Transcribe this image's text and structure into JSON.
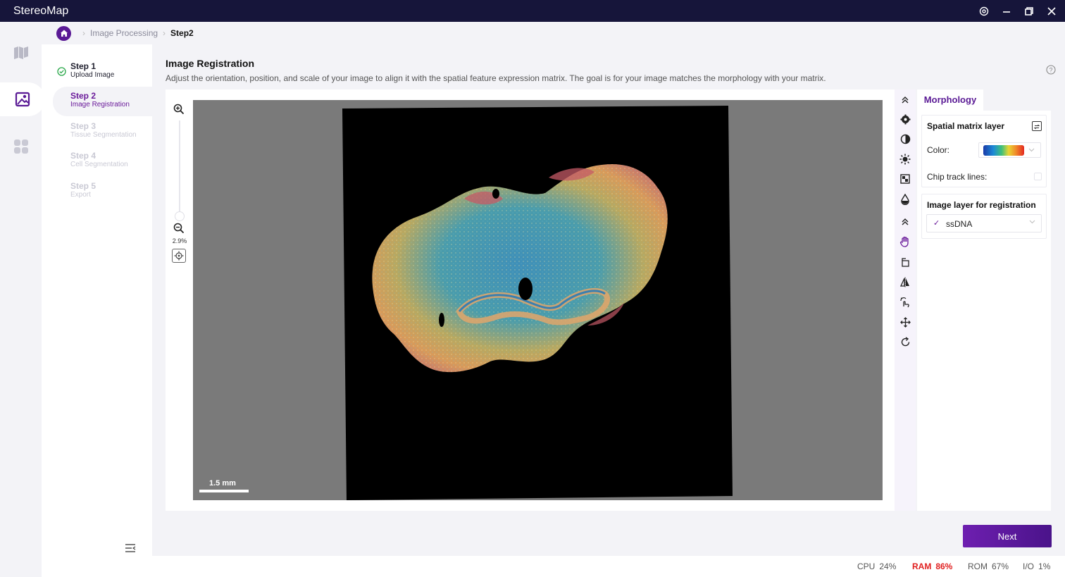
{
  "app": {
    "title": "StereoMap"
  },
  "breadcrumb": {
    "items": [
      "Image Processing",
      "Step2"
    ]
  },
  "steps": [
    {
      "title": "Step 1",
      "subtitle": "Upload Image",
      "state": "done"
    },
    {
      "title": "Step 2",
      "subtitle": "Image Registration",
      "state": "active"
    },
    {
      "title": "Step 3",
      "subtitle": "Tissue Segmentation",
      "state": "todo"
    },
    {
      "title": "Step 4",
      "subtitle": "Cell Segmentation",
      "state": "todo"
    },
    {
      "title": "Step 5",
      "subtitle": "Export",
      "state": "todo"
    }
  ],
  "page": {
    "title": "Image Registration",
    "description": "Adjust the orientation, position, and scale of your image to align it with the spatial feature expression matrix. The goal is for your image matches the morphology with your matrix."
  },
  "viewer": {
    "zoom": "2.9%",
    "scale_bar": "1.5 mm"
  },
  "right_panel": {
    "tab": "Morphology",
    "spatial_group_title": "Spatial matrix layer",
    "color_label": "Color:",
    "chip_track_label": "Chip track lines:",
    "chip_track_checked": false,
    "image_group_title": "Image layer for registration",
    "image_layer_value": "ssDNA"
  },
  "actions": {
    "next_label": "Next"
  },
  "status": {
    "cpu_label": "CPU",
    "cpu_value": "24%",
    "ram_label": "RAM",
    "ram_value": "86%",
    "rom_label": "ROM",
    "rom_value": "67%",
    "io_label": "I/O",
    "io_value": "1%"
  },
  "colors": {
    "brand": "#5a1a95",
    "titlebar": "#16153a",
    "warning": "#e02020"
  }
}
